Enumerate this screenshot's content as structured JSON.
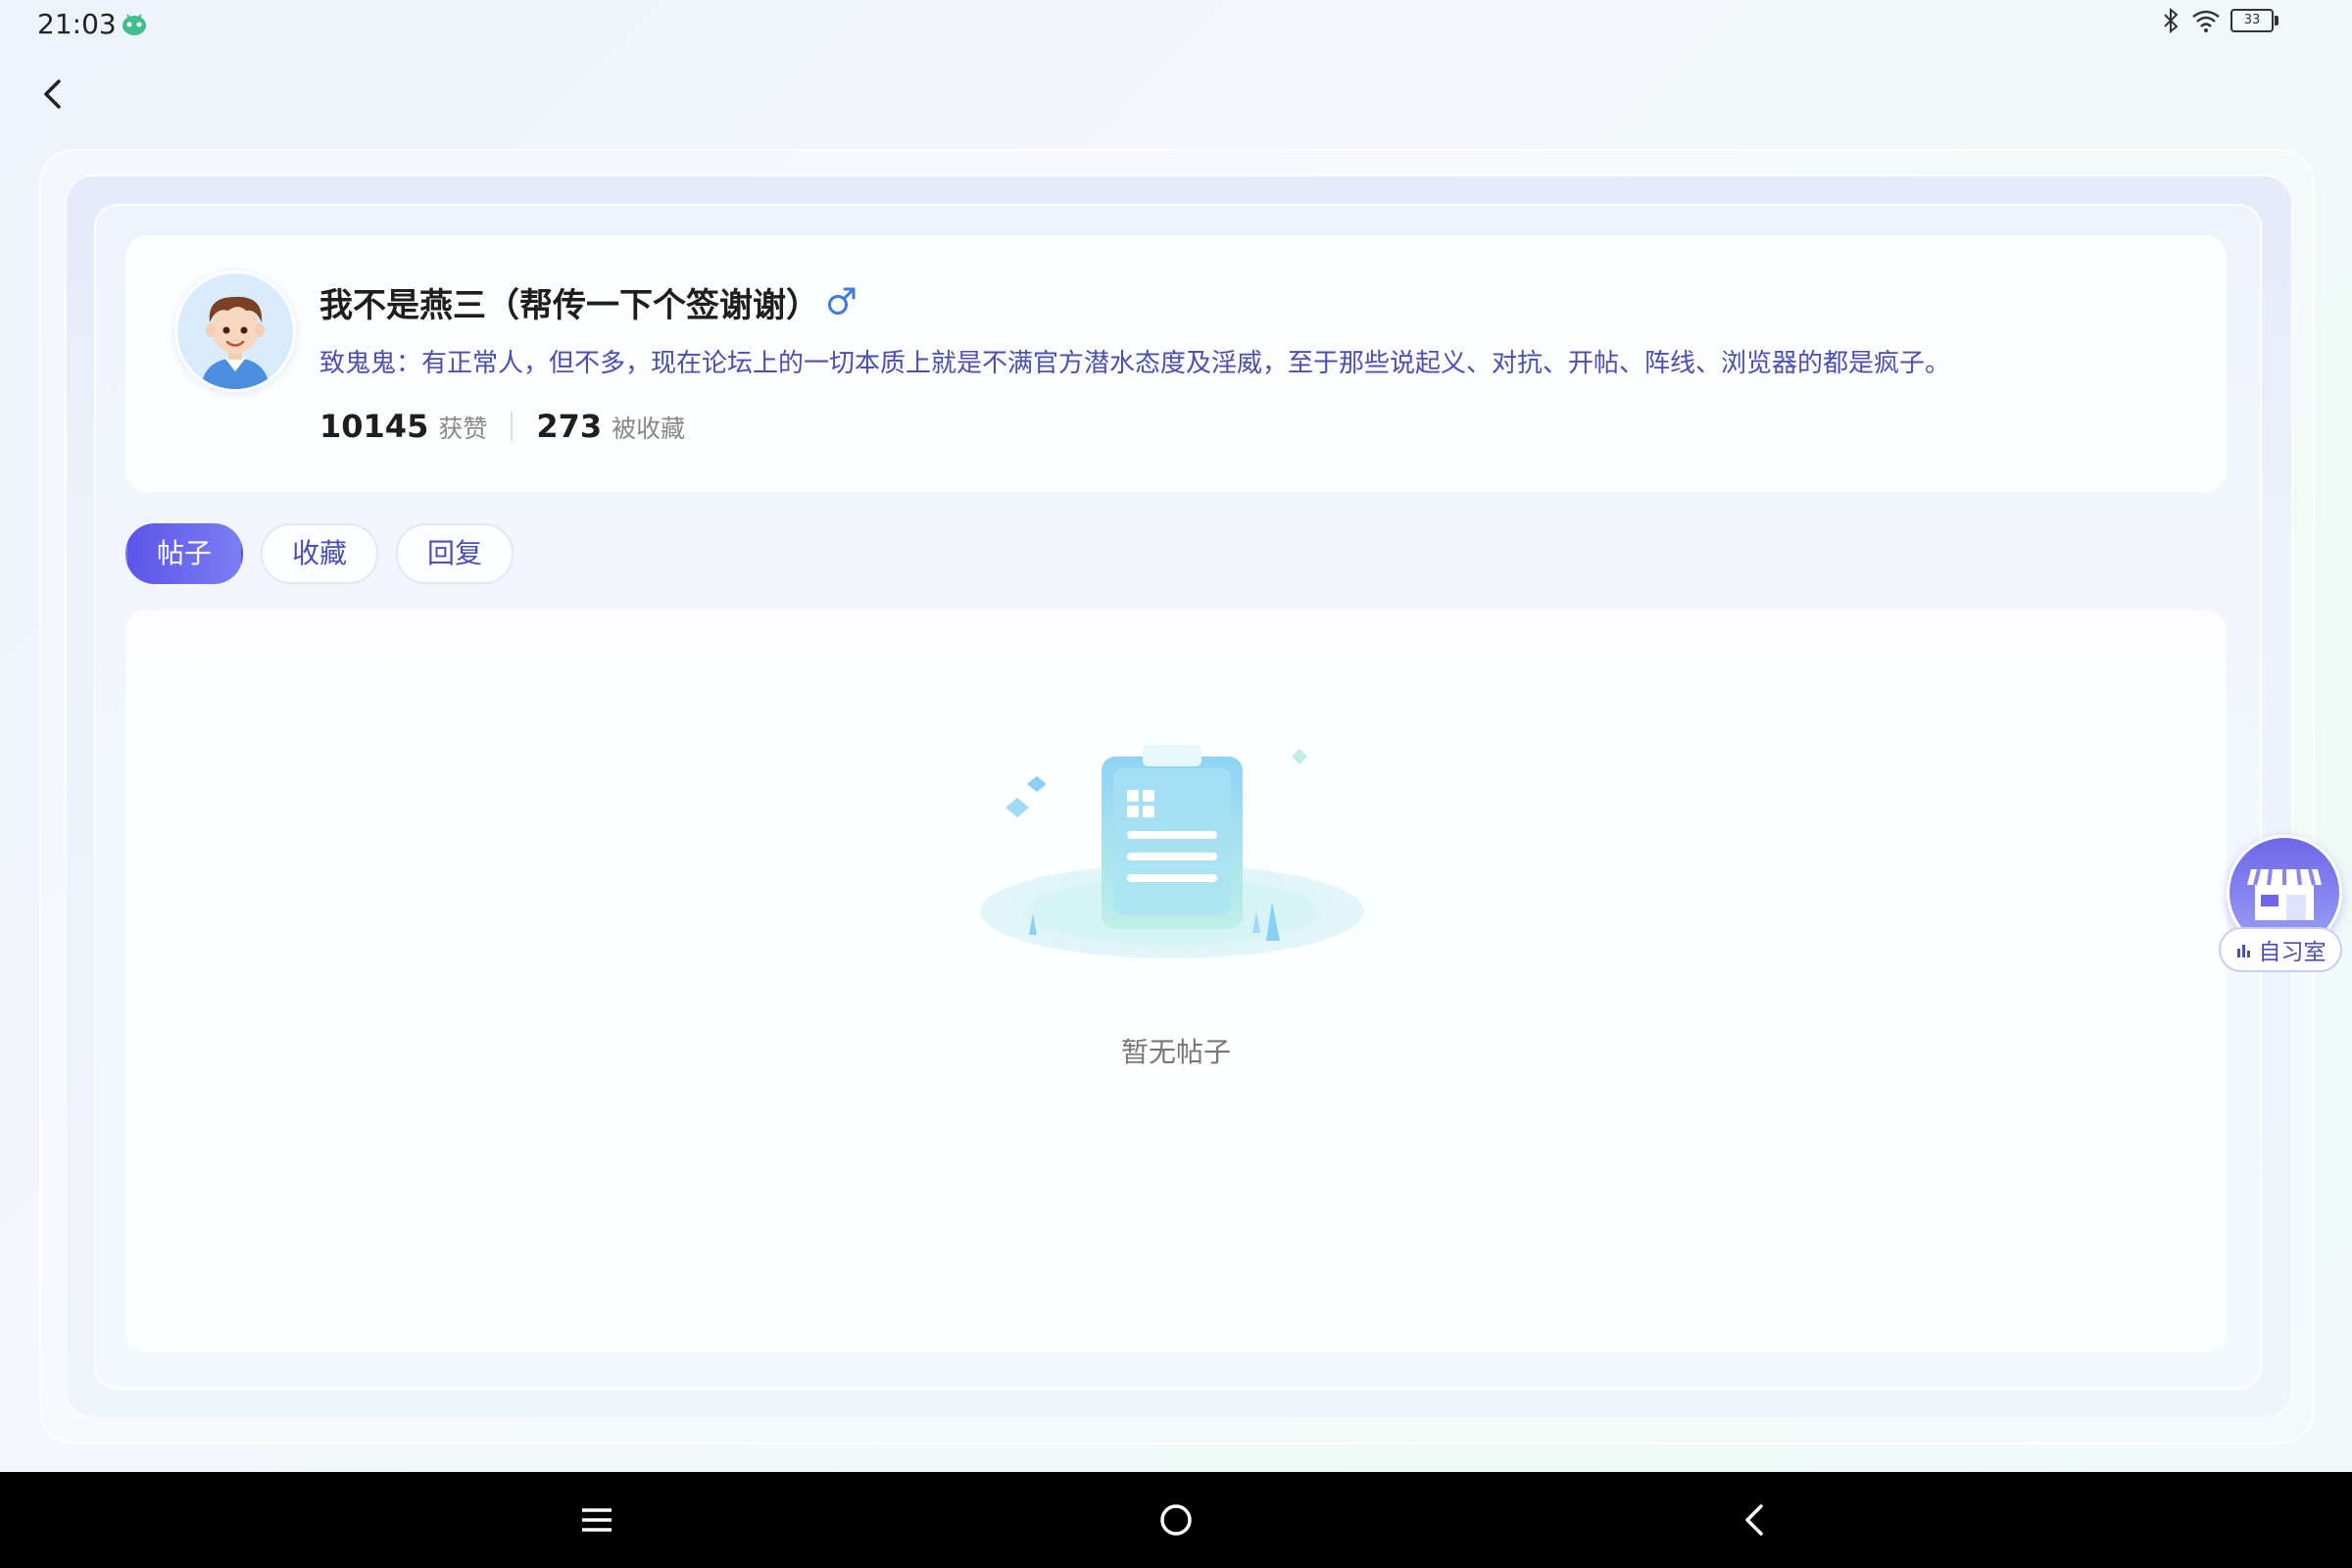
{
  "status_bar": {
    "time": "21:03",
    "app_icon": "android-robot-icon",
    "bluetooth_icon": "bluetooth-icon",
    "wifi_icon": "wifi-icon",
    "battery_level": "33"
  },
  "header": {
    "back_icon": "chevron-left-icon"
  },
  "profile": {
    "username": "我不是燕三（帮传一下个签谢谢）",
    "gender_icon": "male-symbol-icon",
    "signature": "致鬼鬼：有正常人，但不多，现在论坛上的一切本质上就是不满官方潜水态度及淫威，至于那些说起义、对抗、开帖、阵线、浏览器的都是疯子。",
    "likes_count": "10145",
    "likes_label": "获赞",
    "favorited_count": "273",
    "favorited_label": "被收藏"
  },
  "tabs": [
    {
      "label": "帖子",
      "active": true
    },
    {
      "label": "收藏",
      "active": false
    },
    {
      "label": "回复",
      "active": false
    }
  ],
  "empty_state": {
    "illustration": "empty-clipboard-illustration",
    "text": "暂无帖子"
  },
  "floating_widget": {
    "icon": "storefront-icon",
    "label": "自习室"
  },
  "nav_bar": {
    "menu_icon": "menu-icon",
    "home_icon": "home-circle-icon",
    "back_icon": "back-chevron-icon"
  },
  "colors": {
    "accent": "#5d55e8",
    "signature_text": "#4a4fb0",
    "gender_blue": "#3b7be0"
  }
}
